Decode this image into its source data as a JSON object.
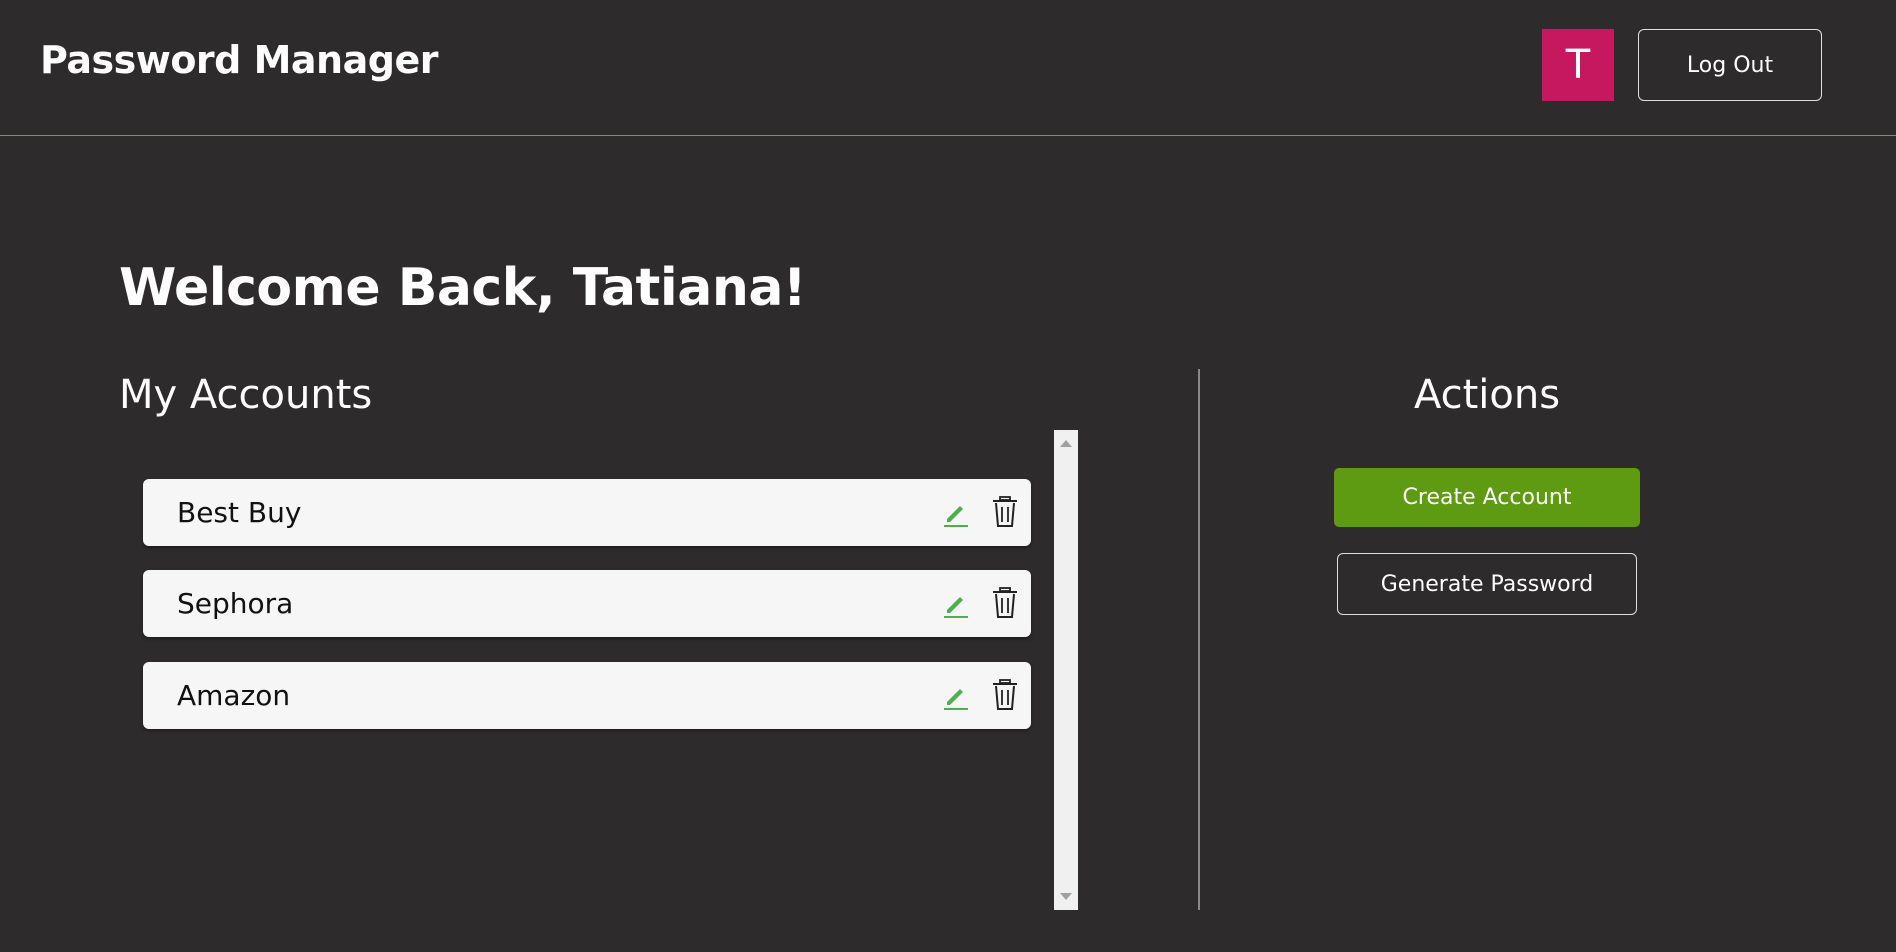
{
  "header": {
    "app_title": "Password Manager",
    "avatar_initial": "T",
    "avatar_color": "#c5185e",
    "logout_label": "Log Out"
  },
  "welcome": "Welcome Back, Tatiana!",
  "accounts": {
    "title": "My Accounts",
    "items": [
      {
        "name": "Best Buy",
        "edit_icon": "pencil-icon",
        "delete_icon": "trash-icon"
      },
      {
        "name": "Sephora",
        "edit_icon": "pencil-icon",
        "delete_icon": "trash-icon"
      },
      {
        "name": "Amazon",
        "edit_icon": "pencil-icon",
        "delete_icon": "trash-icon"
      }
    ]
  },
  "actions": {
    "title": "Actions",
    "create_label": "Create Account",
    "generate_label": "Generate Password"
  },
  "colors": {
    "background": "#2d2b2c",
    "accent_green": "#5e9b13",
    "edit_icon_green": "#4caf50",
    "header_border": "#6ea531"
  }
}
